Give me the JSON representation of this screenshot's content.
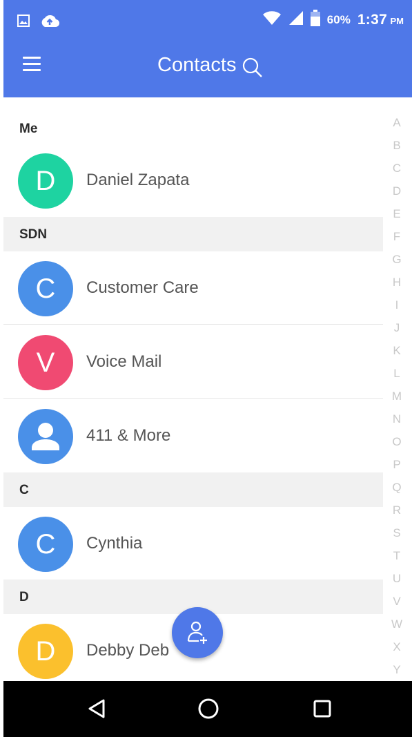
{
  "status_bar": {
    "battery_percent": "60%",
    "time": "1:37",
    "ampm": "PM",
    "icons": [
      "image-icon",
      "cloud-upload-icon",
      "wifi-icon",
      "signal-icon",
      "battery-icon"
    ]
  },
  "app_bar": {
    "title": "Contacts",
    "menu_icon": "hamburger-menu-icon",
    "search_icon": "search-icon"
  },
  "sections": [
    {
      "header": "Me",
      "contacts": [
        {
          "name": "Daniel Zapata",
          "initial": "D",
          "color": "#1ed3a1"
        }
      ]
    },
    {
      "header": "SDN",
      "contacts": [
        {
          "name": "Customer Care",
          "initial": "C",
          "color": "#4a90e8"
        },
        {
          "name": "Voice Mail",
          "initial": "V",
          "color": "#f04a72"
        },
        {
          "name": "411 & More",
          "initial": "",
          "icon": "person-icon",
          "color": "#4a90e8"
        }
      ]
    },
    {
      "header": "C",
      "contacts": [
        {
          "name": "Cynthia",
          "initial": "C",
          "color": "#4a90e8"
        }
      ]
    },
    {
      "header": "D",
      "contacts": [
        {
          "name": "Debby Deb",
          "initial": "D",
          "color": "#fbc02d"
        }
      ]
    }
  ],
  "alphabet_index": [
    "A",
    "B",
    "C",
    "D",
    "E",
    "F",
    "G",
    "H",
    "I",
    "J",
    "K",
    "L",
    "M",
    "N",
    "O",
    "P",
    "Q",
    "R",
    "S",
    "T",
    "U",
    "V",
    "W",
    "X",
    "Y"
  ],
  "fab": {
    "icon": "add-contact-icon"
  },
  "nav_bar": {
    "buttons": [
      "back-icon",
      "home-icon",
      "recents-icon"
    ]
  },
  "colors": {
    "primary": "#4f78e8",
    "section_bg": "#f1f1f1",
    "nav_bg": "#000000"
  }
}
